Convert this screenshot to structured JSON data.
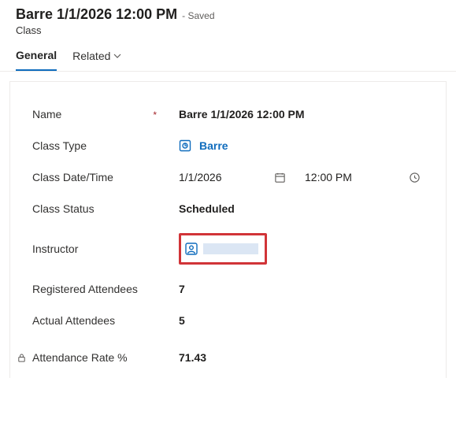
{
  "header": {
    "title": "Barre 1/1/2026 12:00 PM",
    "saved_suffix": "- Saved",
    "entity": "Class"
  },
  "tabs": {
    "general": "General",
    "related": "Related"
  },
  "form": {
    "name": {
      "label": "Name",
      "value": "Barre 1/1/2026 12:00 PM"
    },
    "class_type": {
      "label": "Class Type",
      "value": "Barre"
    },
    "class_datetime": {
      "label": "Class Date/Time",
      "date": "1/1/2026",
      "time": "12:00 PM"
    },
    "class_status": {
      "label": "Class Status",
      "value": "Scheduled"
    },
    "instructor": {
      "label": "Instructor",
      "value": ""
    },
    "registered": {
      "label": "Registered Attendees",
      "value": "7"
    },
    "actual": {
      "label": "Actual Attendees",
      "value": "5"
    },
    "rate": {
      "label": "Attendance Rate %",
      "value": "71.43"
    }
  }
}
